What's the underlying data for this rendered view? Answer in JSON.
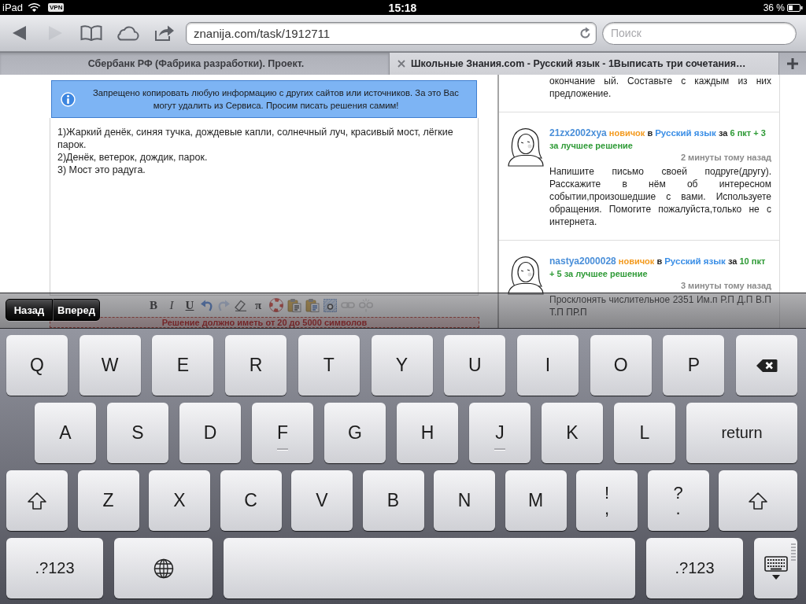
{
  "status_bar": {
    "device": "iPad",
    "vpn": "VPN",
    "time": "15:18",
    "battery": "36 %"
  },
  "toolbar": {
    "buttons": [
      {
        "kind": "back",
        "disabled": false
      },
      {
        "kind": "forward",
        "disabled": true
      },
      {
        "kind": "bookmarks",
        "disabled": false
      },
      {
        "kind": "cloud",
        "disabled": false
      },
      {
        "kind": "share",
        "disabled": false
      }
    ],
    "url": "znanija.com/task/1912711",
    "search": {
      "placeholder": "Поиск"
    }
  },
  "tabs": [
    {
      "title": "Сбербанк РФ (Фабрика разработки). Проект.",
      "selected": false
    },
    {
      "title": "Школьные Знания.com - Русский язык - 1Выписать три сочетания…",
      "selected": true
    }
  ],
  "notice": "Запрещено копировать любую информацию с других сайтов или источников. За это Вас могут удалить из Сервиса. Просим писать решения самим!",
  "editor": {
    "value": "1)Жаркий денёк, синяя тучка, дождевые капли, солнечный луч, красивый мост, лёгкие парок.\n2)Денёк, ветерок, дождик, парок.\n3) Мост это радуга.",
    "toolbar": [
      {
        "kind": "bold",
        "label": "B",
        "disabled": false
      },
      {
        "kind": "italic",
        "label": "I",
        "disabled": false
      },
      {
        "kind": "underline",
        "label": "U",
        "disabled": false
      },
      {
        "kind": "undo",
        "disabled": false
      },
      {
        "kind": "redo",
        "disabled": true
      },
      {
        "kind": "eraser",
        "disabled": false
      },
      {
        "kind": "formula",
        "label": "π",
        "disabled": false
      },
      {
        "kind": "help",
        "disabled": false
      },
      {
        "kind": "paste_text",
        "disabled": false
      },
      {
        "kind": "paste_word",
        "disabled": false
      },
      {
        "kind": "select_all",
        "disabled": false
      },
      {
        "kind": "link",
        "disabled": true
      },
      {
        "kind": "unlink",
        "disabled": true
      }
    ],
    "hint": "Решение должно иметь от 20 до 5000 символов"
  },
  "questions": [
    {
      "text": "окончание ый. Составьте с каждым из них предложение."
    },
    {
      "author": "21zx2002xya",
      "rank": "новичок",
      "in": "в",
      "subject": "Русский язык",
      "for": "за",
      "points": "6 пкт + 3 за лучшее решение",
      "time": "2 минуты тому назад",
      "text": "Напишите письмо своей подруге(другу). Расскажите в нём об интересном событии,произошедшие с вами. Используете обращения. Помогите пожалуйста,только не с интернета."
    },
    {
      "author": "nastya2000028",
      "rank": "новичок",
      "in": "в",
      "subject": "Русский язык",
      "for": "за",
      "points": "10 пкт + 5 за лучшее решение",
      "time": "3 минуты тому назад",
      "text": "Просклонять числительное 2351 Им.п Р.П Д.П В.П Т.П ПР.П"
    }
  ],
  "form_nav": [
    {
      "label": "Назад"
    },
    {
      "label": "Вперед"
    }
  ],
  "keyboard": {
    "rows": [
      {
        "keys": [
          {
            "kind": "letter",
            "label": "Q"
          },
          {
            "kind": "letter",
            "label": "W"
          },
          {
            "kind": "letter",
            "label": "E"
          },
          {
            "kind": "letter",
            "label": "R"
          },
          {
            "kind": "letter",
            "label": "T"
          },
          {
            "kind": "letter",
            "label": "Y"
          },
          {
            "kind": "letter",
            "label": "U"
          },
          {
            "kind": "letter",
            "label": "I"
          },
          {
            "kind": "letter",
            "label": "O"
          },
          {
            "kind": "letter",
            "label": "P"
          },
          {
            "kind": "backspace"
          }
        ]
      },
      {
        "keys": [
          {
            "kind": "letter",
            "label": "A"
          },
          {
            "kind": "letter",
            "label": "S"
          },
          {
            "kind": "letter",
            "label": "D"
          },
          {
            "kind": "home",
            "label": "F"
          },
          {
            "kind": "letter",
            "label": "G"
          },
          {
            "kind": "letter",
            "label": "H"
          },
          {
            "kind": "home",
            "label": "J"
          },
          {
            "kind": "letter",
            "label": "K"
          },
          {
            "kind": "letter",
            "label": "L"
          },
          {
            "kind": "return",
            "label": "return"
          }
        ]
      },
      {
        "keys": [
          {
            "kind": "shift"
          },
          {
            "kind": "letter",
            "label": "Z"
          },
          {
            "kind": "letter",
            "label": "X"
          },
          {
            "kind": "letter",
            "label": "C"
          },
          {
            "kind": "letter",
            "label": "V"
          },
          {
            "kind": "letter",
            "label": "B"
          },
          {
            "kind": "letter",
            "label": "N"
          },
          {
            "kind": "letter",
            "label": "M"
          },
          {
            "kind": "dual",
            "label": "!",
            "alt": ","
          },
          {
            "kind": "dual",
            "label": "?",
            "alt": "."
          },
          {
            "kind": "shift"
          }
        ]
      },
      {
        "keys": [
          {
            "kind": "numbers",
            "label": ".?123"
          },
          {
            "kind": "globe"
          },
          {
            "kind": "space"
          },
          {
            "kind": "numbers",
            "label": ".?123"
          },
          {
            "kind": "hide"
          }
        ]
      }
    ]
  }
}
